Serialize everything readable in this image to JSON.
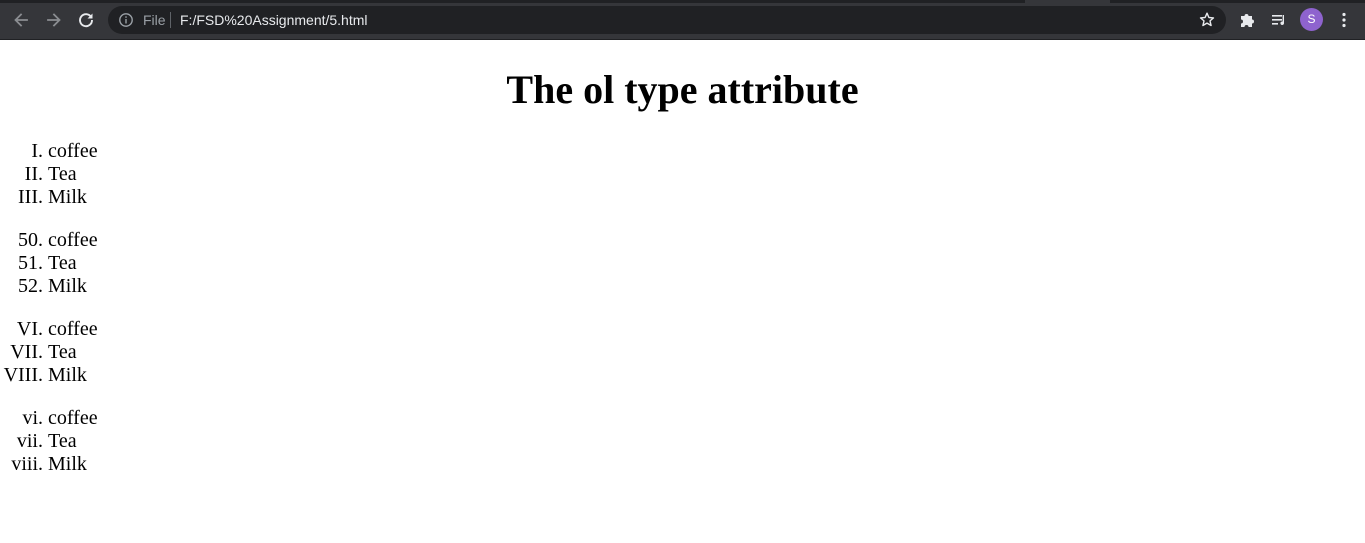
{
  "browser": {
    "url_scheme": "File",
    "url": "F:/FSD%20Assignment/5.html",
    "profile_initial": "S",
    "icons": [
      "back-arrow-icon",
      "forward-arrow-icon",
      "reload-icon",
      "info-icon",
      "star-icon",
      "extensions-puzzle-icon",
      "media-queue-icon",
      "kebab-menu-icon"
    ],
    "colors": {
      "toolbar": "#35363a",
      "omnibox": "#202124",
      "avatar": "#8e63ce"
    }
  },
  "page": {
    "heading": "The ol type attribute",
    "lists": [
      {
        "items": [
          {
            "marker": "I.",
            "text": "coffee"
          },
          {
            "marker": "II.",
            "text": "Tea"
          },
          {
            "marker": "III.",
            "text": "Milk"
          }
        ]
      },
      {
        "items": [
          {
            "marker": "50.",
            "text": "coffee"
          },
          {
            "marker": "51.",
            "text": "Tea"
          },
          {
            "marker": "52.",
            "text": "Milk"
          }
        ]
      },
      {
        "items": [
          {
            "marker": "VI.",
            "text": "coffee"
          },
          {
            "marker": "VII.",
            "text": "Tea"
          },
          {
            "marker": "VIII.",
            "text": "Milk"
          }
        ]
      },
      {
        "items": [
          {
            "marker": "vi.",
            "text": "coffee"
          },
          {
            "marker": "vii.",
            "text": "Tea"
          },
          {
            "marker": "viii.",
            "text": "Milk"
          }
        ]
      }
    ]
  }
}
